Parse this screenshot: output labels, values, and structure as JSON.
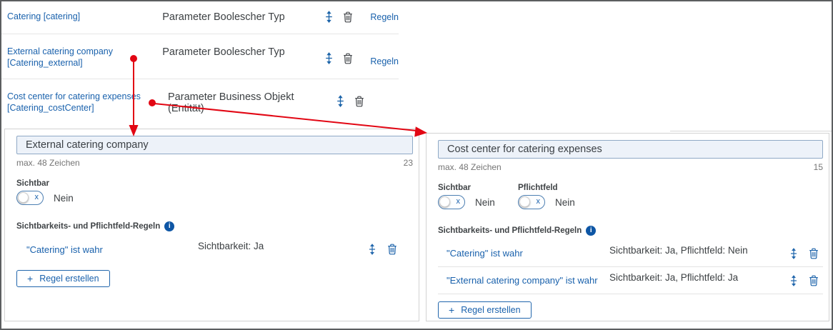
{
  "colors": {
    "link_blue": "#1961ac",
    "info_blue": "#0e56a5",
    "arrow_red": "#e20613",
    "text_dark": "#3c4043",
    "input_bg": "#edf2f9",
    "input_border": "#8fa9c6"
  },
  "icons": {
    "toggle_off_glyph": "x",
    "info_glyph": "i",
    "plus_glyph": "+"
  },
  "top_rows": [
    {
      "label": "Catering [catering]",
      "type": "Parameter Boolescher Typ",
      "rules_link": "Regeln"
    },
    {
      "label": "External catering company [Catering_external]",
      "type": "Parameter Boolescher Typ",
      "rules_link": "Regeln"
    },
    {
      "label": "Cost center for catering expenses [Catering_costCenter]",
      "type": "Parameter Business Objekt (Entität)",
      "rules_link": ""
    }
  ],
  "panels": [
    {
      "name_value": "External catering company",
      "hint": "max. 48 Zeichen",
      "char_count": "23",
      "toggles": [
        {
          "label": "Sichtbar",
          "state_text": "Nein"
        }
      ],
      "rules_heading": "Sichtbarkeits- und Pflichtfeld-Regeln",
      "rules": [
        {
          "condition": "\"Catering\" ist wahr",
          "effect": "Sichtbarkeit: Ja"
        }
      ],
      "create_rule_label": "Regel erstellen"
    },
    {
      "name_value": "Cost center for catering expenses",
      "hint": "max. 48 Zeichen",
      "char_count": "15",
      "toggles": [
        {
          "label": "Sichtbar",
          "state_text": "Nein"
        },
        {
          "label": "Pflichtfeld",
          "state_text": "Nein"
        }
      ],
      "rules_heading": "Sichtbarkeits- und Pflichtfeld-Regeln",
      "rules": [
        {
          "condition": "\"Catering\" ist wahr",
          "effect": "Sichtbarkeit: Ja, Pflichtfeld: Nein"
        },
        {
          "condition": "\"External catering company\" ist wahr",
          "effect": "Sichtbarkeit: Ja, Pflichtfeld: Ja"
        }
      ],
      "create_rule_label": "Regel erstellen"
    }
  ]
}
